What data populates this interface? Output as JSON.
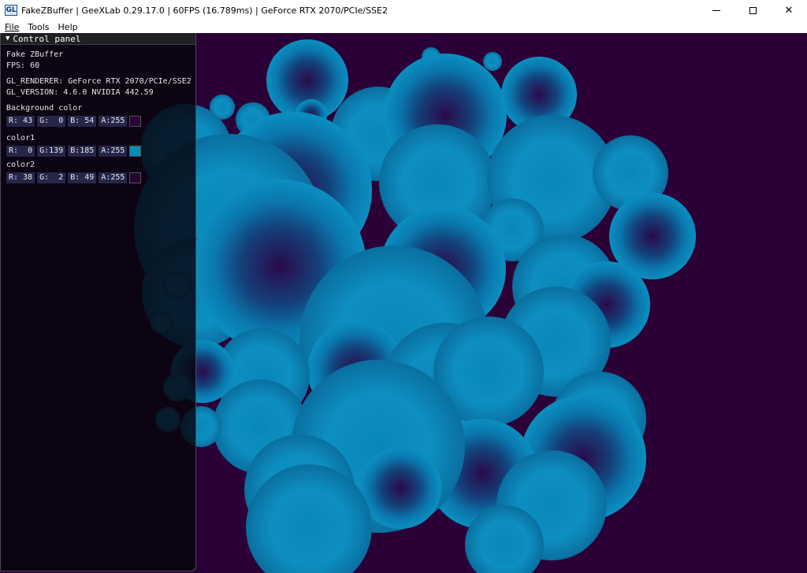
{
  "window": {
    "title": "FakeZBuffer | GeeXLab 0.29.17.0 | 60FPS (16.789ms) | GeForce RTX 2070/PCIe/SSE2",
    "icon_label": "GL",
    "controls": [
      "minimize-icon",
      "maximize-icon",
      "close-icon"
    ],
    "close_glyph": "✕"
  },
  "menu": [
    "File",
    "Tools",
    "Help"
  ],
  "panel": {
    "header": "Control panel",
    "demo_name": "Fake ZBuffer",
    "fps": "FPS: 60",
    "renderer": "GL_RENDERER: GeForce RTX 2070/PCIe/SSE2",
    "version": "GL_VERSION: 4.6.0 NVIDIA 442.59",
    "background": {
      "label": "Background color",
      "r": "R: 43",
      "g": "G:  0",
      "b": "B: 54",
      "a": "A:255",
      "swatch": "#2b0036"
    },
    "color1": {
      "label": "color1",
      "r": "R:  0",
      "g": "G:139",
      "b": "B:185",
      "a": "A:255",
      "swatch": "#008bb9"
    },
    "color2": {
      "label": "color2",
      "r": "R: 38",
      "g": "G:  2",
      "b": "B: 49",
      "a": "A:255",
      "swatch": "#260231"
    }
  },
  "colors": {
    "background": "#2b0036",
    "sphere_light": "#0b8fc0",
    "sphere_dark": "#2a0a4a"
  }
}
